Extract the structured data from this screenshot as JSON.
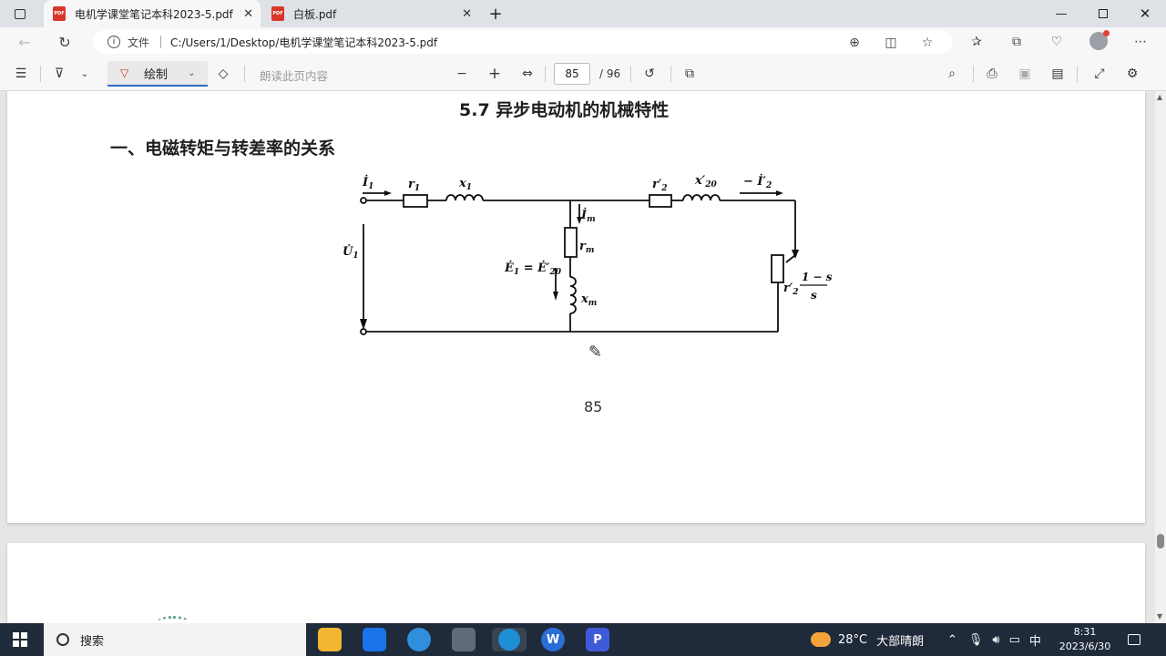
{
  "tabs": [
    {
      "title": "电机学课堂笔记本科2023-5.pdf",
      "icon": "PDF",
      "active": true
    },
    {
      "title": "白板.pdf",
      "icon": "PDF",
      "active": false
    }
  ],
  "address": {
    "scheme_label": "文件",
    "url": "C:/Users/1/Desktop/电机学课堂笔记本科2023-5.pdf"
  },
  "pdf_toolbar": {
    "draw_label": "绘制",
    "read_aloud_label": "朗读此页内容",
    "current_page": "85",
    "total_pages": "/ 96"
  },
  "document": {
    "section_title": "5.7 异步电动机的机械特性",
    "subsection_title": "一、电磁转矩与转差率的关系",
    "page_number": "85",
    "circuit_labels": {
      "i1": "İ",
      "i1_sub": "1",
      "r1": "r",
      "r1_sub": "1",
      "x1": "x",
      "x1_sub": "1",
      "r2p": "r′",
      "r2p_sub": "2",
      "x20p": "x′",
      "x20p_sub": "20",
      "i2p": "− İ′",
      "i2p_sub": "2",
      "im": "İ",
      "im_sub": "m",
      "rm": "r",
      "rm_sub": "m",
      "xm": "x",
      "xm_sub": "m",
      "u1": "U̇",
      "u1_sub": "1",
      "e1": "Ė",
      "e1_sub": "1",
      "eq": " = Ė′",
      "e20_sub": "20",
      "load_r": "r′",
      "load_r_sub": "2",
      "frac_num": "1 − s",
      "frac_den": "s"
    }
  },
  "taskbar": {
    "search_label": "搜索",
    "weather_temp": "28°C",
    "weather_text": "大部晴朗",
    "ime_label": "中",
    "time": "8:31",
    "date": "2023/6/30",
    "apps": [
      {
        "name": "file-explorer",
        "glyph": "",
        "color": "#f2b632"
      },
      {
        "name": "store",
        "glyph": "",
        "color": "#1a73e8"
      },
      {
        "name": "browser-swirl",
        "glyph": "",
        "color": "#2f8fdc"
      },
      {
        "name": "calculator",
        "glyph": "",
        "color": "#5f6a7a"
      },
      {
        "name": "edge",
        "glyph": "",
        "color": "#1c8fd6"
      },
      {
        "name": "wps-writer",
        "glyph": "W",
        "color": "#2b6ed6"
      },
      {
        "name": "powerpoint-like",
        "glyph": "P",
        "color": "#3d5bd9"
      }
    ]
  },
  "colors": {
    "accent": "#2b6cc4",
    "pdf_red": "#d9362b",
    "taskbar_bg": "#1f2a3a"
  }
}
